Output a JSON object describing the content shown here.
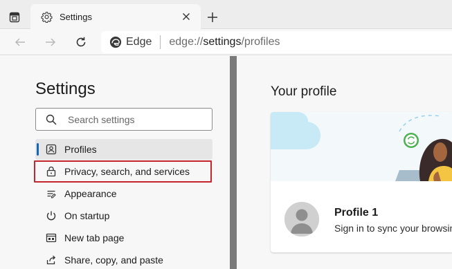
{
  "tab": {
    "title": "Settings",
    "actions_icon": "tab-actions-icon",
    "favicon": "gear-icon",
    "close_icon": "close-icon",
    "new_tab_icon": "plus-icon"
  },
  "toolbar": {
    "back_icon": "back-arrow-icon",
    "forward_icon": "forward-arrow-icon",
    "refresh_icon": "refresh-icon",
    "site_label": "Edge",
    "url_prefix": "edge://",
    "url_strong": "settings",
    "url_suffix": "/profiles"
  },
  "sidebar": {
    "title": "Settings",
    "search": {
      "placeholder": "Search settings"
    },
    "items": [
      {
        "label": "Profiles",
        "icon": "profile-icon"
      },
      {
        "label": "Privacy, search, and services",
        "icon": "lock-icon"
      },
      {
        "label": "Appearance",
        "icon": "appearance-icon"
      },
      {
        "label": "On startup",
        "icon": "power-icon"
      },
      {
        "label": "New tab page",
        "icon": "new-tab-page-icon"
      },
      {
        "label": "Share, copy, and paste",
        "icon": "share-icon"
      }
    ]
  },
  "content": {
    "heading": "Your profile",
    "profile": {
      "name": "Profile 1",
      "subtitle": "Sign in to sync your browsing data"
    }
  },
  "colors": {
    "accent": "#1565c0",
    "highlight_border": "#c4242b",
    "sidebar_bg": "#f7f7f7",
    "tabstrip_bg": "#ededed"
  }
}
